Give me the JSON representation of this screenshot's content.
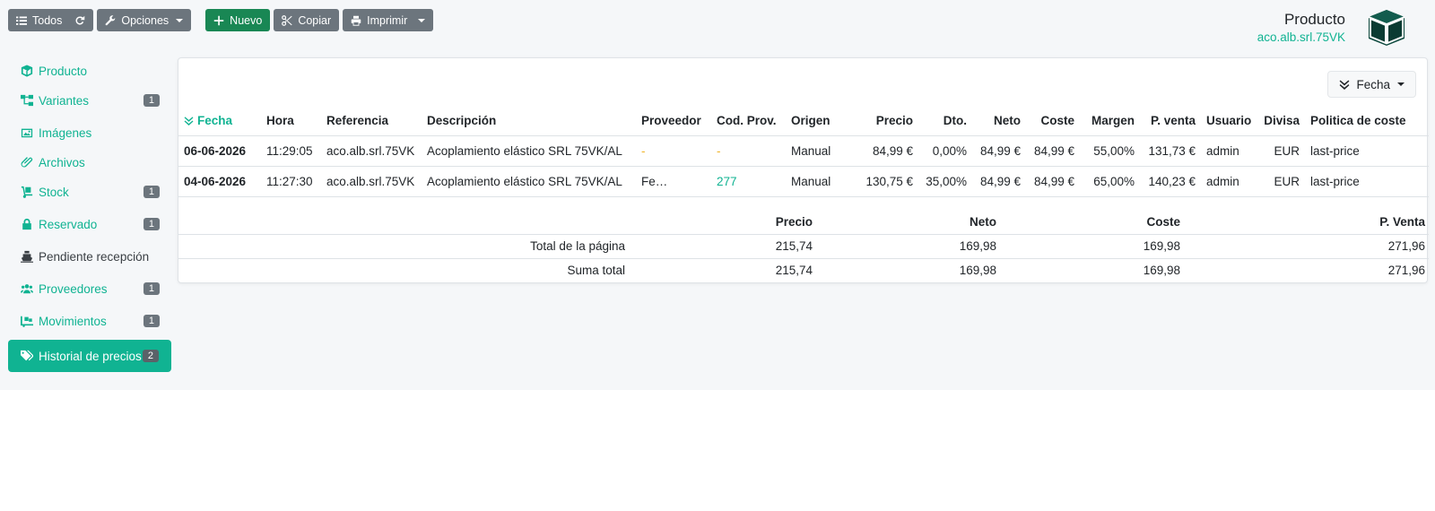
{
  "toolbar": {
    "all_label": "Todos",
    "options_label": "Opciones",
    "new_label": "Nuevo",
    "copy_label": "Copiar",
    "print_label": "Imprimir"
  },
  "header": {
    "title": "Producto",
    "reference": "aco.alb.srl.75VK"
  },
  "sidebar": {
    "items": [
      {
        "label": "Producto",
        "icon": "cube-icon"
      },
      {
        "label": "Variantes",
        "icon": "sitemap-icon",
        "badge": "1"
      },
      {
        "label": "Imágenes",
        "icon": "images-icon"
      },
      {
        "label": "Archivos",
        "icon": "paperclip-icon"
      },
      {
        "label": "Stock",
        "icon": "dolly-icon",
        "badge": "1"
      },
      {
        "label": "Reservado",
        "icon": "lock-icon",
        "badge": "1"
      },
      {
        "label": "Pendiente recepción",
        "icon": "ship-icon"
      },
      {
        "label": "Proveedores",
        "icon": "users-icon",
        "badge": "1"
      },
      {
        "label": "Movimientos",
        "icon": "truck-loading-icon",
        "badge": "1"
      },
      {
        "label": "Historial de precios",
        "icon": "tags-icon",
        "badge": "2"
      }
    ]
  },
  "sort": {
    "label": "Fecha"
  },
  "table": {
    "headers": [
      "Fecha",
      "Hora",
      "Referencia",
      "Descripción",
      "Proveedor",
      "Cod. Prov.",
      "Origen",
      "Precio",
      "Dto.",
      "Neto",
      "Coste",
      "Margen",
      "P. venta",
      "Usuario",
      "Divisa",
      "Politica de coste"
    ],
    "rows": [
      [
        "06-06-2026",
        "11:29:05",
        "aco.alb.srl.75VK",
        "Acoplamiento elástico SRL 75VK/AL",
        "-",
        "-",
        "Manual",
        "84,99 €",
        "0,00%",
        "84,99 €",
        "84,99 €",
        "55,00%",
        "131,73 €",
        "admin",
        "EUR",
        "last-price"
      ],
      [
        "04-06-2026",
        "11:27:30",
        "aco.alb.srl.75VK",
        "Acoplamiento elástico SRL 75VK/AL",
        "Fe…",
        "277",
        "Manual",
        "130,75 €",
        "35,00%",
        "84,99 €",
        "84,99 €",
        "65,00%",
        "140,23 €",
        "admin",
        "EUR",
        "last-price"
      ]
    ]
  },
  "totals": {
    "headers": [
      "Precio",
      "Neto",
      "Coste",
      "P. Venta"
    ],
    "rows": [
      {
        "label": "Total de la página",
        "values": [
          "215,74",
          "169,98",
          "169,98",
          "271,96"
        ]
      },
      {
        "label": "Suma total",
        "values": [
          "215,74",
          "169,98",
          "169,98",
          "271,96"
        ]
      }
    ]
  },
  "colors": {
    "accent": "#10b392",
    "success": "#198754",
    "secondary": "#6c757d",
    "warning": "#f0b429"
  }
}
